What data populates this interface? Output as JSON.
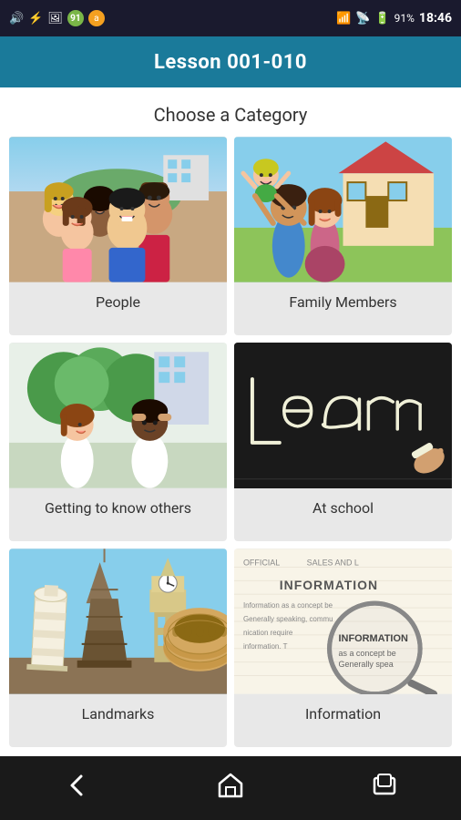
{
  "statusBar": {
    "time": "18:46",
    "battery": "91%",
    "icons": [
      "usb",
      "sd",
      "screenshot",
      "circle",
      "avast"
    ]
  },
  "titleBar": {
    "title": "Lesson 001-010"
  },
  "page": {
    "subtitle": "Choose a Category"
  },
  "categories": [
    {
      "id": "people",
      "label": "People",
      "imageType": "people"
    },
    {
      "id": "family",
      "label": "Family Members",
      "imageType": "family"
    },
    {
      "id": "getting",
      "label": "Getting to know others",
      "imageType": "getting"
    },
    {
      "id": "school",
      "label": "At school",
      "imageType": "school"
    },
    {
      "id": "landmarks",
      "label": "Landmarks",
      "imageType": "landmarks"
    },
    {
      "id": "information",
      "label": "Information",
      "imageType": "information"
    }
  ],
  "navBar": {
    "back": "←",
    "home": "⌂",
    "recent": "▭"
  }
}
